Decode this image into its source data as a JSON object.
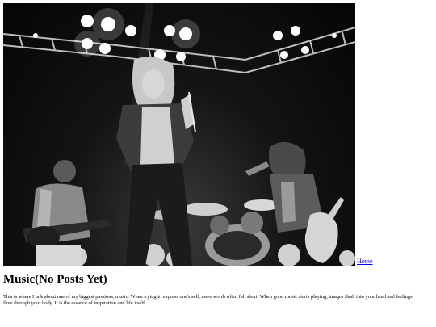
{
  "nav": {
    "home_label": "Home"
  },
  "page": {
    "title": "Music(No Posts Yet)",
    "intro": "This is where I talk about one of my biggest passions, music. When trying to express one's self, mere words often fall short. When good music starts playing, images flash into your head and feelings flow through your body. It is the essance of inspiration and life itself."
  },
  "banner": {
    "alt": "Black and white photo of a rock band performing on stage"
  }
}
